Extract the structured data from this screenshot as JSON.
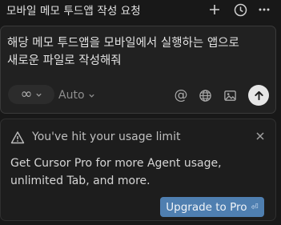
{
  "header": {
    "title": "모바일 메모 투드앱 작성 요청"
  },
  "composer": {
    "prompt_text": "해당 메모 투드앱을 모바일에서 실행하는 앱으로 새로운 파일로 작성해줘",
    "mode_symbol": "∞",
    "model_label": "Auto",
    "mention_symbol": "@"
  },
  "usage_notice": {
    "title": "You've hit your usage limit",
    "body": "Get Cursor Pro for more Agent usage, unlimited Tab, and more.",
    "upgrade_label": "Upgrade to Pro",
    "upgrade_shortcut": "⏎"
  },
  "colors": {
    "background": "#181818",
    "panel": "#212121",
    "upgrade_button": "#4f7fb0"
  },
  "icons": [
    "plus-icon",
    "history-icon",
    "more-icon",
    "infinity-icon",
    "chevron-down-icon",
    "at-icon",
    "globe-icon",
    "image-icon",
    "arrow-up-icon",
    "warning-icon",
    "close-icon",
    "enter-icon"
  ]
}
